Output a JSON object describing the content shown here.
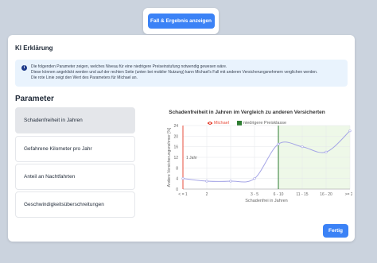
{
  "top_button": {
    "label": "Fall & Ergebnis anzeigen"
  },
  "panel": {
    "title": "KI Erklärung",
    "info_lines": [
      "Die folgenden Parameter zeigen, welches Niveau für eine niedrigere Preiseinstufung notwendig gewesen wäre.",
      "Diese können angeklickt werden und auf der rechten Seite (unten bei mobiler Nutzung) kann Michael's Fall mit anderen Versicherungsnehmern verglichen werden.",
      "Die rote Linie zeigt den Wert des Parameters für Michael an."
    ],
    "params_title": "Parameter",
    "params": [
      "Schadenfreiheit in Jahren",
      "Gefahrene Kilometer pro Jahr",
      "Anteil an Nachtfahrten",
      "Geschwindigkeitsüberschreitungen"
    ],
    "done_label": "Fertig"
  },
  "colors": {
    "primary": "#3b82f6",
    "michael_line": "#e74c3c",
    "lower_class": "#2e7d32",
    "curve": "#a5a5e6",
    "shade": "#eef8e8"
  },
  "chart_data": {
    "type": "line",
    "title": "Schadenfreiheit in Jahren im Vergleich zu anderen Versicherten",
    "xlabel": "Schadenfrei in Jahren",
    "ylabel": "Andere Versicherungsnehmer [%]",
    "categories": [
      "< = 1",
      "2",
      "3 - 5",
      "6 - 10",
      "11 - 15",
      "16 - 20",
      ">= 26"
    ],
    "values": [
      4,
      3,
      3,
      4,
      17,
      16,
      14,
      22
    ],
    "x_positions": [
      0,
      1,
      2,
      3,
      4,
      5,
      6,
      7
    ],
    "ylim": [
      0,
      24
    ],
    "yticks": [
      0,
      4,
      8,
      12,
      16,
      20,
      24
    ],
    "michael_x_label": "1 Jahr",
    "legend": [
      {
        "name": "Michael",
        "type": "line",
        "color": "#e74c3c"
      },
      {
        "name": "niedrigere Preisklasse",
        "type": "box",
        "color": "#2e7d32"
      }
    ],
    "lower_class_from": "6 - 10",
    "grid": true,
    "legend_position": "top"
  }
}
